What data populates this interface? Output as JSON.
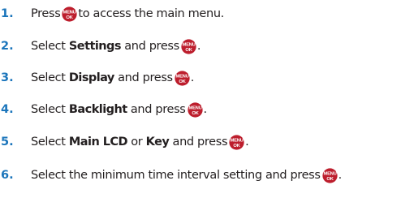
{
  "key_icon": {
    "name": "menu-ok-key-icon",
    "top_text": "MENU",
    "bottom_text": "OK",
    "fill": "#bd1e2d",
    "text_color": "#ffffff"
  },
  "steps": [
    {
      "number": "1.",
      "text_before": "Press",
      "text_after": "to access the main menu."
    },
    {
      "number": "2.",
      "text_before": "Select",
      "bold": "Settings",
      "text_after": "and press",
      "end": "."
    },
    {
      "number": "3.",
      "text_before": "Select",
      "bold": "Display",
      "text_after": "and press",
      "end": "."
    },
    {
      "number": "4.",
      "text_before": "Select",
      "bold": "Backlight",
      "text_after": "and press",
      "end": "."
    },
    {
      "number": "5.",
      "text_before": "Select",
      "bold": "Main LCD",
      "text_mid": "or",
      "bold2": "Key",
      "text_after": "and press",
      "end": "."
    },
    {
      "number": "6.",
      "text_before": "Select the minimum time interval setting and press",
      "end": "."
    }
  ]
}
